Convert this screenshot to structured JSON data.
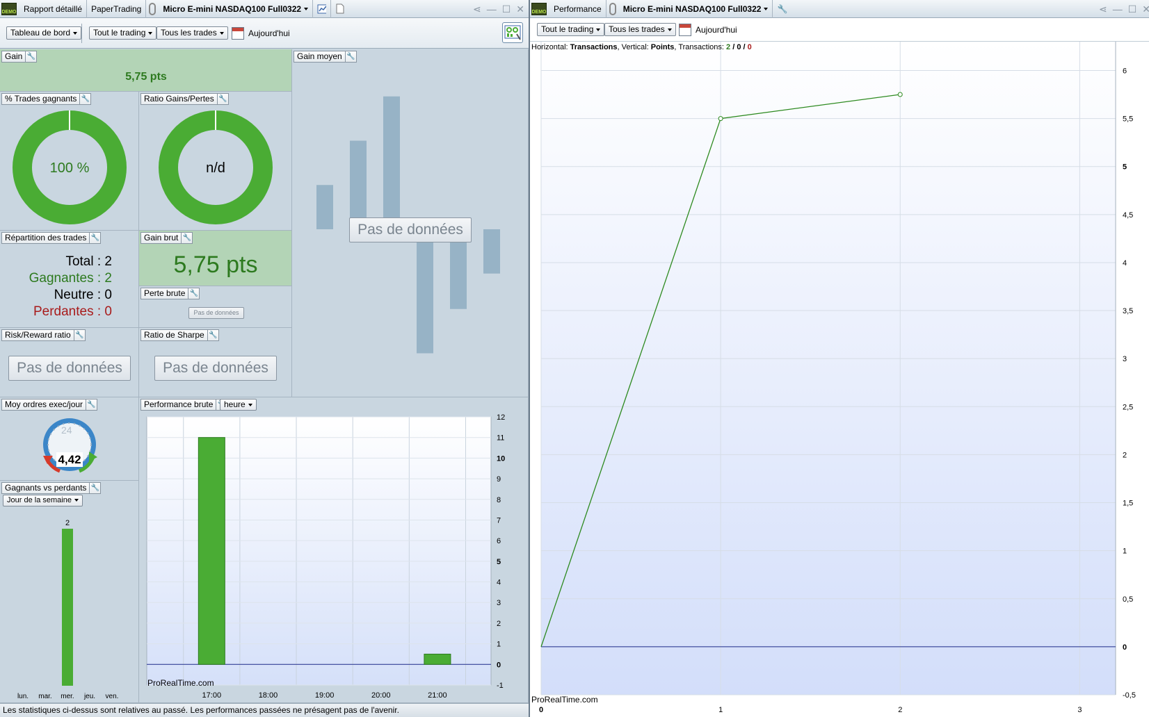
{
  "left_window": {
    "tabs": [
      "Rapport détaillé",
      "PaperTrading",
      "Micro E-mini NASDAQ100 Full0322"
    ],
    "badge": "DEMO",
    "toolbar": {
      "dashboard": "Tableau de bord",
      "trading": "Tout le trading",
      "trades": "Tous les trades",
      "date": "Aujourd'hui"
    }
  },
  "right_window": {
    "badge": "DEMO",
    "tabs": [
      "Performance",
      "Micro E-mini NASDAQ100 Full0322"
    ],
    "toolbar": {
      "trading": "Tout le trading",
      "trades": "Tous les trades",
      "date": "Aujourd'hui"
    },
    "info": {
      "h_label": "Horizontal: ",
      "h_value": "Transactions",
      "v_label": ", Vertical: ",
      "v_value": "Points",
      "t_label": ", Transactions: ",
      "t_win": "2",
      "sep1": " / ",
      "t_neutral": "0",
      "sep2": " / ",
      "t_lose": "0"
    },
    "watermark": "ProRealTime.com"
  },
  "panels": {
    "gain": {
      "title": "Gain",
      "value": "5,75 pts"
    },
    "winrate": {
      "title": "% Trades gagnants",
      "value": "100 %"
    },
    "ratio": {
      "title": "Ratio Gains/Pertes",
      "value": "n/d"
    },
    "avg_gain": {
      "title": "Gain moyen",
      "nodata": "Pas de données"
    },
    "distribution": {
      "title": "Répartition des trades",
      "total": "Total : 2",
      "winners": "Gagnantes : 2",
      "neutral": "Neutre : 0",
      "losers": "Perdantes : 0"
    },
    "gross_gain": {
      "title": "Gain brut",
      "value": "5,75 pts"
    },
    "gross_loss": {
      "title": "Perte brute",
      "nodata": "Pas de données"
    },
    "risk_reward": {
      "title": "Risk/Reward ratio",
      "nodata": "Pas de données"
    },
    "sharpe": {
      "title": "Ratio de Sharpe",
      "nodata": "Pas de données"
    },
    "avg_orders": {
      "title": "Moy ordres exec/jour",
      "value": "4,42",
      "dial": "24"
    },
    "gross_perf": {
      "title": "Performance brute",
      "unit": "heure",
      "watermark": "ProRealTime.com"
    },
    "win_vs_loss": {
      "title": "Gagnants vs perdants",
      "period": "Jour de la semaine"
    }
  },
  "status": "Les statistiques ci-dessus sont relatives au passé. Les performances passées ne présagent pas de l'avenir.",
  "colors": {
    "green": "#4aac34",
    "dark_green": "#2d7a1f",
    "red": "#a81b1b",
    "panel_bg": "#c9d6e0",
    "bar_blue": "#97b3c6"
  },
  "chart_data": [
    {
      "type": "bar",
      "id": "gain_moyen_placeholder",
      "values": [
        2.5,
        5.0,
        7.5,
        -7.0,
        -4.5,
        -2.5
      ],
      "note": "placeholder bars, no axis labels"
    },
    {
      "type": "bar",
      "id": "performance_brute",
      "categories": [
        "17:00",
        "18:00",
        "19:00",
        "20:00",
        "21:00"
      ],
      "values": [
        11,
        0,
        0,
        0,
        0.5
      ],
      "y_ticks": [
        "12",
        "11",
        "10",
        "9",
        "8",
        "7",
        "6",
        "5",
        "4",
        "3",
        "2",
        "1",
        "0",
        "-1"
      ],
      "ylim": [
        -1,
        12
      ]
    },
    {
      "type": "bar",
      "id": "gagnants_vs_perdants",
      "categories": [
        "lun.",
        "mar.",
        "mer.",
        "jeu.",
        "ven."
      ],
      "values": [
        0,
        0,
        2,
        0,
        0
      ],
      "labels": [
        "",
        "",
        "2",
        "",
        ""
      ]
    },
    {
      "type": "line",
      "id": "performance",
      "x": [
        0,
        1,
        2
      ],
      "y": [
        0,
        5.5,
        5.75
      ],
      "x_ticks": [
        "0",
        "1",
        "2",
        "3"
      ],
      "y_ticks": [
        "6",
        "5,5",
        "5",
        "4,5",
        "4",
        "3,5",
        "3",
        "2,5",
        "2",
        "1,5",
        "1",
        "0,5",
        "0",
        "-0,5"
      ],
      "xlim": [
        0,
        3.2
      ],
      "ylim": [
        -0.5,
        6.3
      ]
    }
  ]
}
